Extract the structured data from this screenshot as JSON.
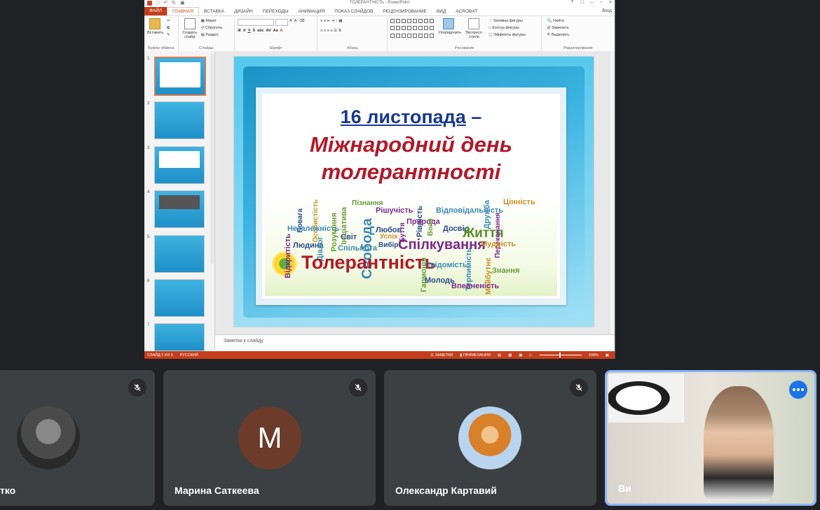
{
  "ppt": {
    "window_title": "ТОЛЕРАНТНІСТЬ - PowerPoint",
    "tabs": [
      "ФАЙЛ",
      "ГЛАВНАЯ",
      "ВСТАВКА",
      "ДИЗАЙН",
      "ПЕРЕХОДЫ",
      "АНИМАЦИЯ",
      "ПОКАЗ СЛАЙДОВ",
      "РЕЦЕНЗИРОВАНИЕ",
      "ВИД",
      "ACROBAT"
    ],
    "login": "Вход",
    "ribbon": {
      "paste": "Вставить",
      "new_slide": "Создать слайд",
      "layout": "Макет",
      "reset": "Сбросить",
      "section": "Раздел",
      "arrange": "Упорядочить",
      "quick_styles": "Экспресс-стили",
      "shape_fill": "Заливка фигуры",
      "shape_outline": "Контур фигуры",
      "shape_effects": "Эффекты фигуры",
      "find": "Найти",
      "replace": "Заменить",
      "select": "Выделить",
      "groups": [
        "Буфер обмена",
        "Слайды",
        "Шрифт",
        "Абзац",
        "Рисование",
        "Редактирование"
      ]
    },
    "slide_numbers": [
      "1",
      "2",
      "3",
      "4",
      "5",
      "6",
      "7"
    ],
    "slide": {
      "line1_date": "16 листопада",
      "line1_dash": " –",
      "line2": "Міжнародний день",
      "line3": "толерантності",
      "words": [
        {
          "text": "Особистість",
          "color": "#c98e2a"
        },
        {
          "text": "Пізнання",
          "color": "#6a9a36"
        },
        {
          "text": "Повага",
          "color": "#2b4a8a"
        },
        {
          "text": "Незалежність",
          "color": "#3a8ab5"
        },
        {
          "text": "Ініціатива",
          "color": "#6a9a36"
        },
        {
          "text": "Рішучість",
          "color": "#7a2a8a"
        },
        {
          "text": "Рівність",
          "color": "#2b4a8a"
        },
        {
          "text": "Відповідальність",
          "color": "#3a8ab5"
        },
        {
          "text": "Дружба",
          "color": "#3a8ab5"
        },
        {
          "text": "Цінність",
          "color": "#c98e2a"
        },
        {
          "text": "Розуміння",
          "color": "#6a9a36"
        },
        {
          "text": "Свобода",
          "color": "#3a8ab5"
        },
        {
          "text": "Любов",
          "color": "#2b4a8a"
        },
        {
          "text": "Природа",
          "color": "#7a2a8a"
        },
        {
          "text": "Воля",
          "color": "#6a9a36"
        },
        {
          "text": "Досвід",
          "color": "#2b4a8a"
        },
        {
          "text": "Життя",
          "color": "#5a8a2a"
        },
        {
          "text": "Переконання",
          "color": "#7a2a8a"
        },
        {
          "text": "Людина",
          "color": "#2b4a8a"
        },
        {
          "text": "Діалог",
          "color": "#3a8ab5"
        },
        {
          "text": "Світ",
          "color": "#2b4a8a"
        },
        {
          "text": "Успіх",
          "color": "#c98e2a"
        },
        {
          "text": "Буття",
          "color": "#7a2a8a"
        },
        {
          "text": "Вибір",
          "color": "#2b4a8a"
        },
        {
          "text": "Спілкування",
          "color": "#7a2a8a"
        },
        {
          "text": "Мудрість",
          "color": "#c98e2a"
        },
        {
          "text": "Відкритість",
          "color": "#7a2a8a"
        },
        {
          "text": "Спільнота",
          "color": "#3a8ab5"
        },
        {
          "text": "Толерантність",
          "color": "#b2192a"
        },
        {
          "text": "Гармонія",
          "color": "#6a9a36"
        },
        {
          "text": "Свідомість",
          "color": "#3a8ab5"
        },
        {
          "text": "Молодь",
          "color": "#2b4a8a"
        },
        {
          "text": "Терпимість",
          "color": "#3a8ab5"
        },
        {
          "text": "Майбутнє",
          "color": "#c98e2a"
        },
        {
          "text": "Знання",
          "color": "#6a9a36"
        },
        {
          "text": "Впевненість",
          "color": "#7a2a8a"
        }
      ]
    },
    "notes_placeholder": "Заметки к слайду",
    "status": {
      "slide": "СЛАЙД 1 ИЗ 9",
      "language": "РУССКИЙ",
      "notes": "ЗАМЕТКИ",
      "comments": "ПРИМЕЧАНИЯ",
      "zoom": "108%"
    }
  },
  "participants": [
    {
      "name": "тко",
      "muted": true
    },
    {
      "name": "Марина Саткеева",
      "initial": "М",
      "avatar_color": "#6d3b2a",
      "muted": true
    },
    {
      "name": "Олександр Картавий",
      "muted": true
    },
    {
      "name": "Ви",
      "self": true
    }
  ]
}
